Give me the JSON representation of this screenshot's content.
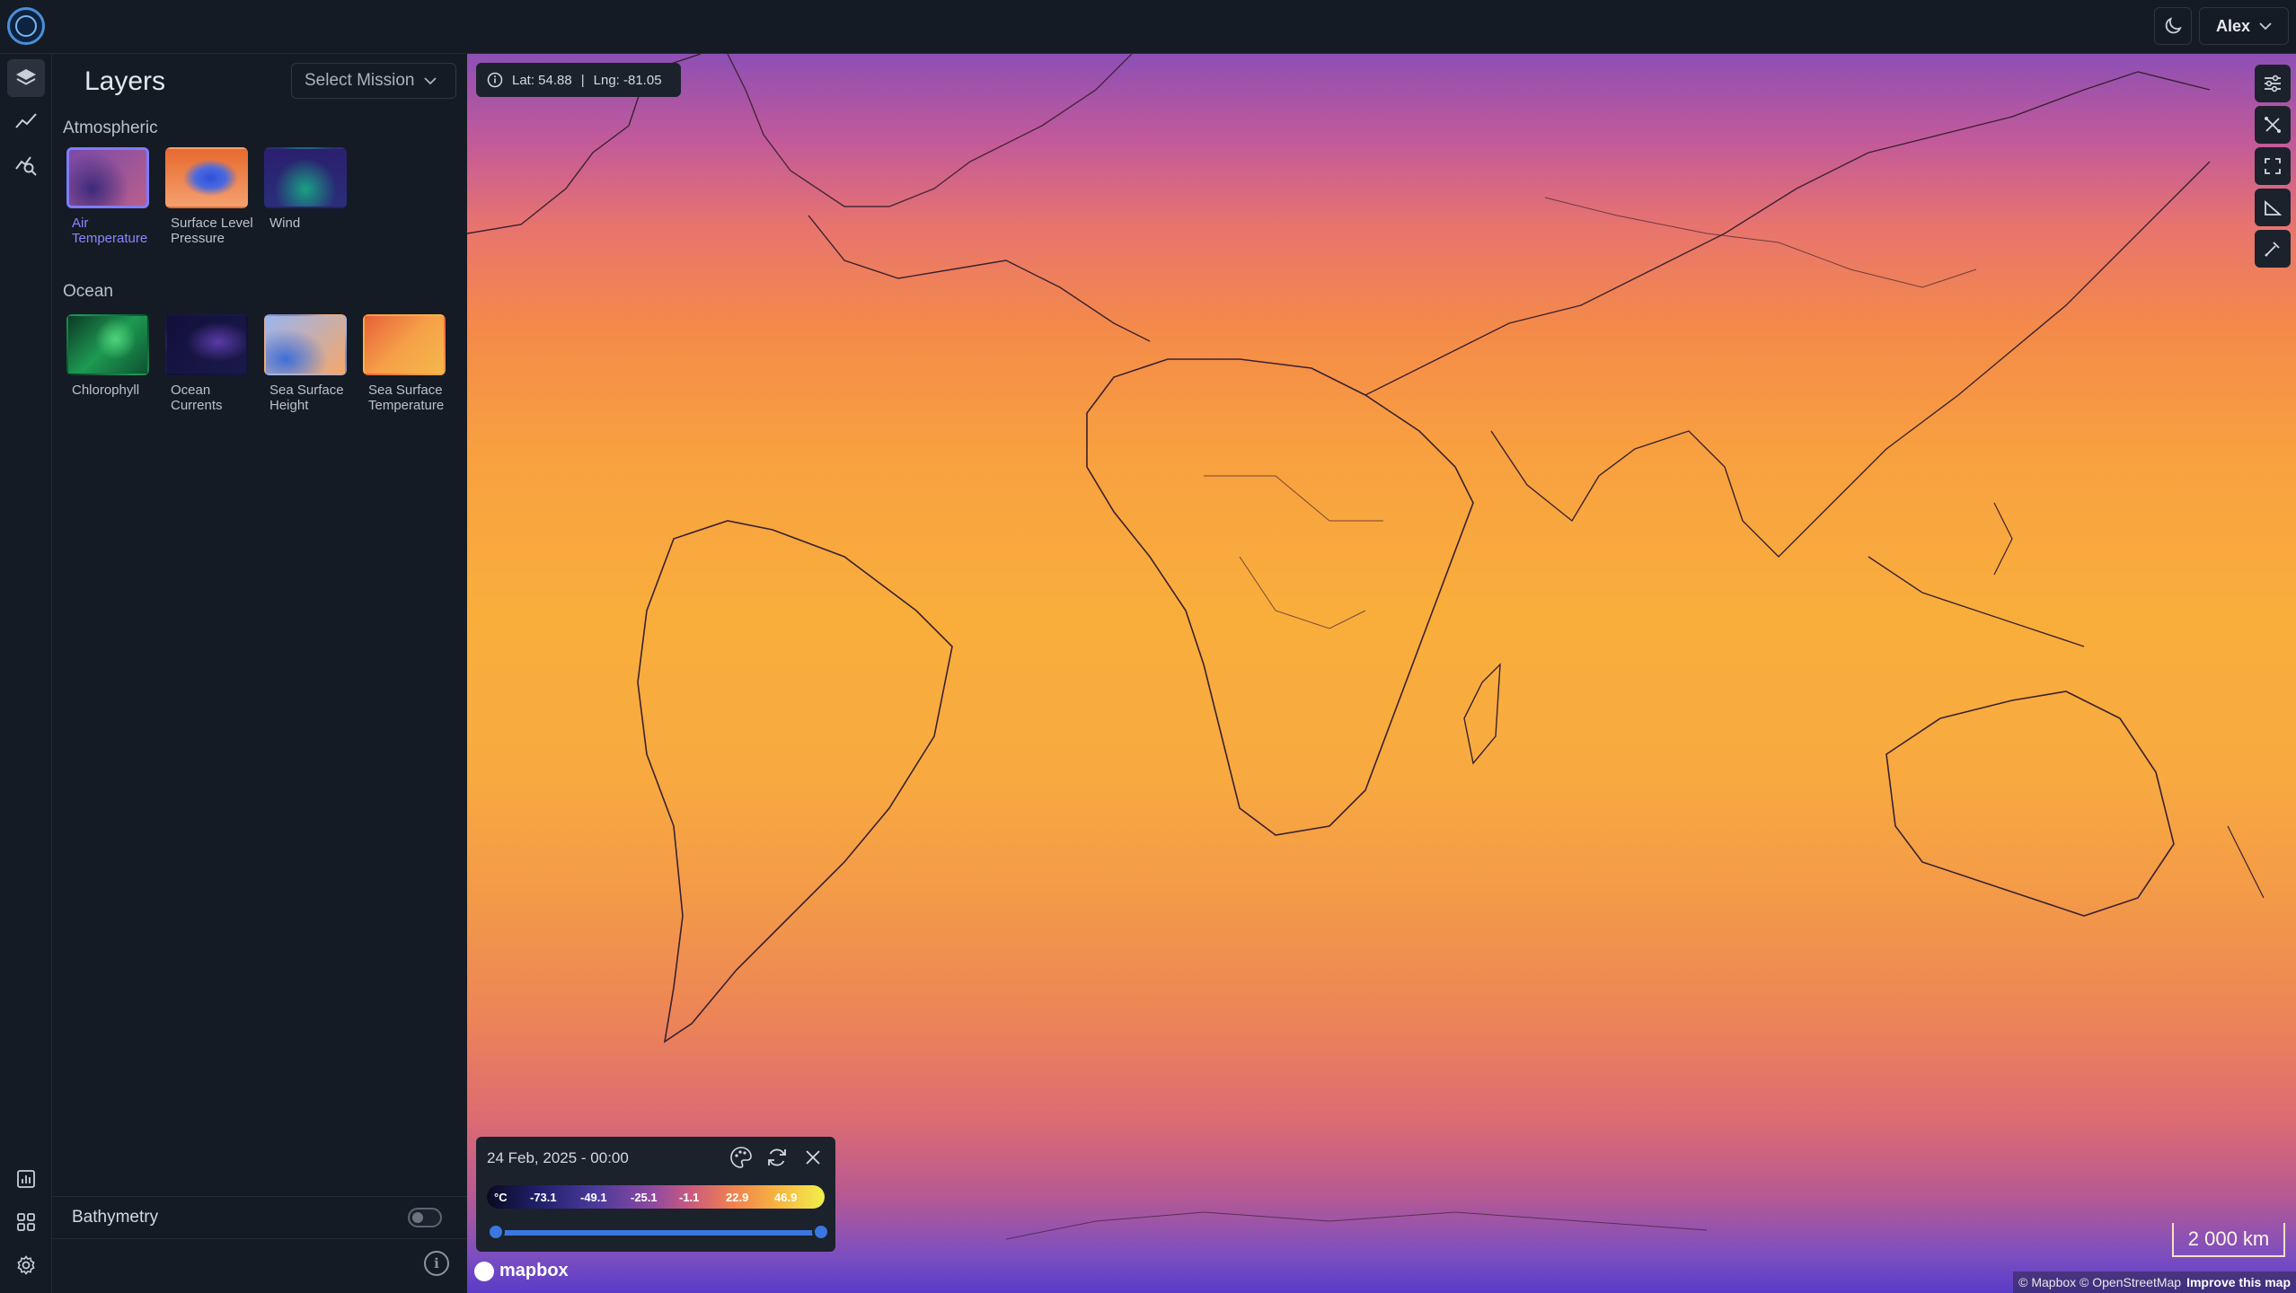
{
  "app": {
    "user": "Alex"
  },
  "panel": {
    "title": "Layers",
    "mission_select": "Select Mission",
    "sections": [
      {
        "label": "Atmospheric",
        "layers": [
          {
            "name": "Air Temperature",
            "selected": true,
            "thumb": [
              "#3d2a7a",
              "#7a4aa8",
              "#b85f8c"
            ]
          },
          {
            "name": "Surface Level Pressure",
            "selected": false,
            "thumb": [
              "#e86a2e",
              "#2f4fd8",
              "#f4a070"
            ]
          },
          {
            "name": "Wind",
            "selected": false,
            "thumb": [
              "#2a1f6e",
              "#1aa084",
              "#2a2f7a"
            ]
          }
        ]
      },
      {
        "label": "Ocean",
        "layers": [
          {
            "name": "Chlorophyll",
            "selected": false,
            "thumb": [
              "#0c3a26",
              "#1e9a52",
              "#0d5232"
            ]
          },
          {
            "name": "Ocean Currents",
            "selected": false,
            "thumb": [
              "#120f3a",
              "#5a3aa8",
              "#1a1a4a"
            ]
          },
          {
            "name": "Sea Surface Height",
            "selected": false,
            "thumb": [
              "#3f6ed8",
              "#f4a86a",
              "#9ab4f0"
            ]
          },
          {
            "name": "Sea Surface Temperature",
            "selected": false,
            "thumb": [
              "#e8603a",
              "#f6a048",
              "#f4b84a"
            ]
          }
        ]
      }
    ],
    "bathymetry": {
      "label": "Bathymetry",
      "enabled": false
    }
  },
  "map": {
    "lat_text": "Lat: 54.88",
    "lng_text": "Lng: -81.05",
    "legend": {
      "date": "24 Feb, 2025 - 00:00",
      "unit": "°C",
      "ticks": [
        "-73.1",
        "-49.1",
        "-25.1",
        "-1.1",
        "22.9",
        "46.9"
      ],
      "range": [
        0,
        1
      ]
    },
    "scale_text": "2 000 km",
    "attribution": "© Mapbox © OpenStreetMap",
    "improve_link": "Improve this map",
    "mapbox_logo": "mapbox"
  },
  "icons": {
    "rail_top": [
      "layers-icon",
      "chart-line-icon",
      "analysis-icon"
    ],
    "rail_bottom": [
      "bar-chart-icon",
      "apps-grid-icon",
      "settings-gear-icon"
    ],
    "map_tools": [
      "sliders-icon",
      "draw-polygon-icon",
      "fullscreen-icon",
      "ruler-icon",
      "eyedropper-icon"
    ]
  }
}
